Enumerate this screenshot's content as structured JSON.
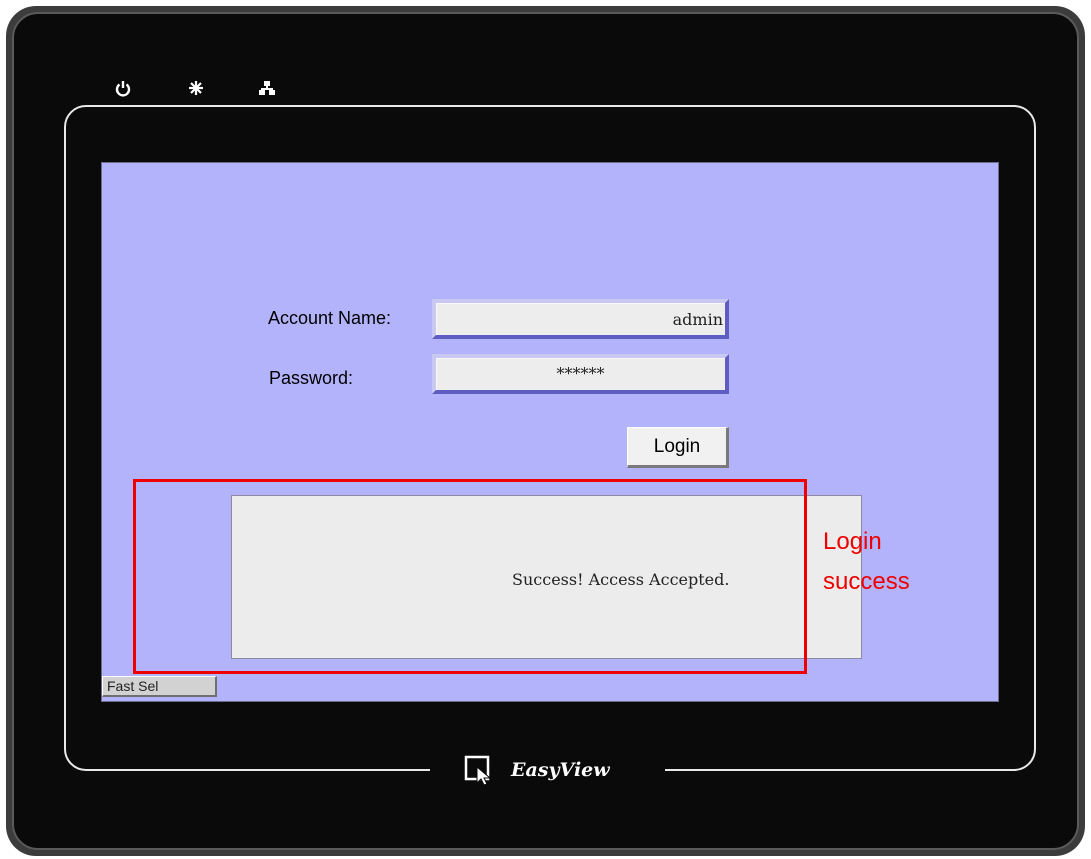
{
  "device": {
    "brand": "EasyView",
    "status_icons": [
      "power-icon",
      "asterisk-icon",
      "network-icon"
    ]
  },
  "login_form": {
    "account_label": "Account Name:",
    "account_value": "admin",
    "password_label": "Password:",
    "password_value": "******",
    "login_button": "Login"
  },
  "message": {
    "text": "Success! Access Accepted."
  },
  "fast_sel_label": "Fast Sel",
  "annotation": {
    "line1": "Login",
    "line2": "success",
    "color": "#ee0000"
  },
  "colors": {
    "screen_bg": "#b3b3fc",
    "bezel": "#0a0a0a"
  }
}
